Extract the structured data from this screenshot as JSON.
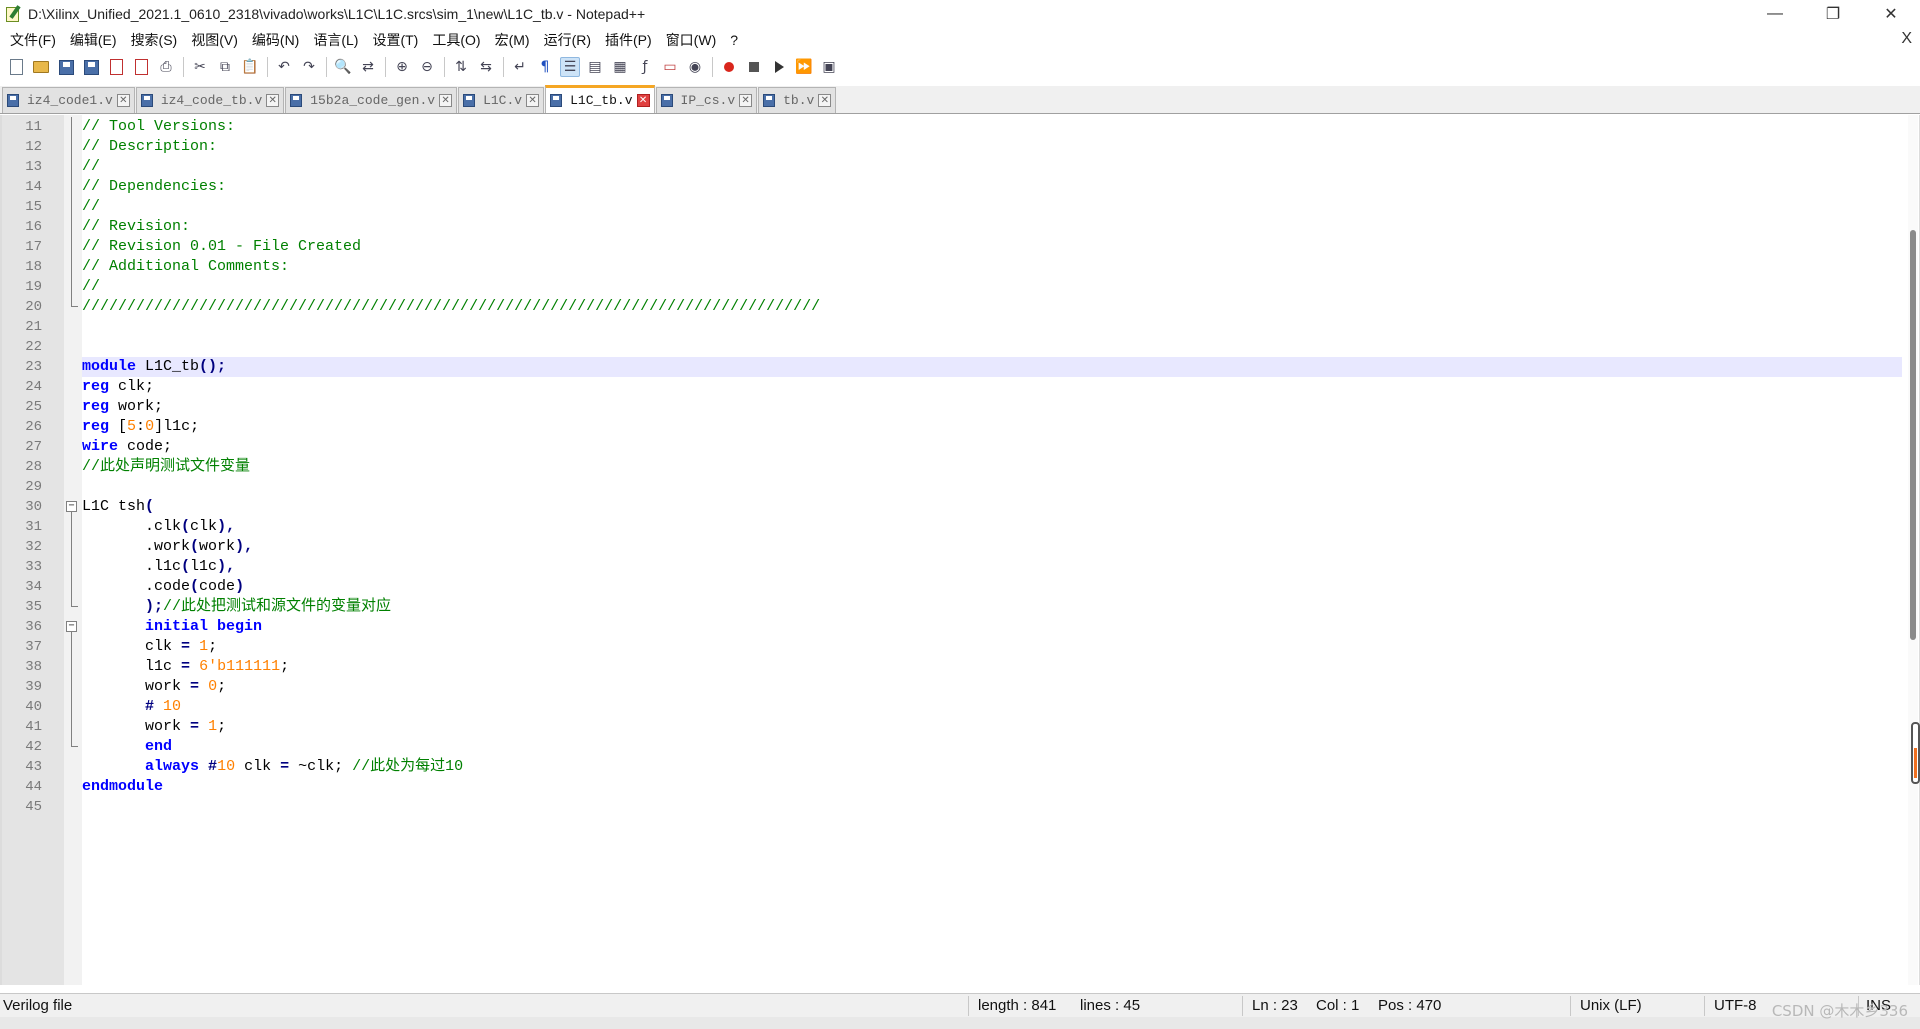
{
  "window": {
    "title": "D:\\Xilinx_Unified_2021.1_0610_2318\\vivado\\works\\L1C\\L1C.srcs\\sim_1\\new\\L1C_tb.v - Notepad++",
    "minimize": "—",
    "maximize": "❐",
    "close": "✕"
  },
  "menu": {
    "items": [
      "文件(F)",
      "编辑(E)",
      "搜索(S)",
      "视图(V)",
      "编码(N)",
      "语言(L)",
      "设置(T)",
      "工具(O)",
      "宏(M)",
      "运行(R)",
      "插件(P)",
      "窗口(W)",
      "?"
    ],
    "close": "X"
  },
  "toolbar": {
    "icons": [
      "new-file-icon",
      "open-file-icon",
      "save-icon",
      "save-all-icon",
      "close-icon",
      "close-all-icon",
      "print-icon",
      "cut-icon",
      "copy-icon",
      "paste-icon",
      "undo-icon",
      "redo-icon",
      "find-icon",
      "replace-icon",
      "zoom-in-icon",
      "zoom-out-icon",
      "sync-vertical-icon",
      "sync-horizontal-icon",
      "word-wrap-icon",
      "show-all-chars-icon",
      "indent-guide-icon",
      "language-icon",
      "doc-map-icon",
      "function-list-icon",
      "folder-workspace-icon",
      "monitor-icon",
      "record-macro-icon",
      "stop-macro-icon",
      "play-macro-icon",
      "run-macro-multiple-icon",
      "save-macro-icon"
    ]
  },
  "tabs": [
    {
      "label": "iz4_code1.v",
      "active": false
    },
    {
      "label": "iz4_code_tb.v",
      "active": false
    },
    {
      "label": "15b2a_code_gen.v",
      "active": false
    },
    {
      "label": "L1C.v",
      "active": false
    },
    {
      "label": "L1C_tb.v",
      "active": true
    },
    {
      "label": "IP_cs.v",
      "active": false
    },
    {
      "label": "tb.v",
      "active": false
    }
  ],
  "editor": {
    "current_line": 23,
    "lines": [
      {
        "n": "11",
        "tokens": [
          [
            "c-comment",
            "// Tool Versions:"
          ]
        ]
      },
      {
        "n": "12",
        "tokens": [
          [
            "c-comment",
            "// Description:"
          ]
        ]
      },
      {
        "n": "13",
        "tokens": [
          [
            "c-comment",
            "//"
          ]
        ]
      },
      {
        "n": "14",
        "tokens": [
          [
            "c-comment",
            "// Dependencies:"
          ]
        ]
      },
      {
        "n": "15",
        "tokens": [
          [
            "c-comment",
            "//"
          ]
        ]
      },
      {
        "n": "16",
        "tokens": [
          [
            "c-comment",
            "// Revision:"
          ]
        ]
      },
      {
        "n": "17",
        "tokens": [
          [
            "c-comment",
            "// Revision 0.01 - File Created"
          ]
        ]
      },
      {
        "n": "18",
        "tokens": [
          [
            "c-comment",
            "// Additional Comments:"
          ]
        ]
      },
      {
        "n": "19",
        "tokens": [
          [
            "c-comment",
            "//"
          ]
        ]
      },
      {
        "n": "20",
        "tokens": [
          [
            "c-comment",
            "//////////////////////////////////////////////////////////////////////////////////"
          ]
        ]
      },
      {
        "n": "21",
        "tokens": []
      },
      {
        "n": "22",
        "tokens": []
      },
      {
        "n": "23",
        "tokens": [
          [
            "c-kw",
            "module"
          ],
          [
            "c-text",
            " L1C_tb"
          ],
          [
            "c-op",
            "();"
          ]
        ]
      },
      {
        "n": "24",
        "tokens": [
          [
            "c-kw",
            "reg"
          ],
          [
            "c-text",
            " clk;"
          ]
        ]
      },
      {
        "n": "25",
        "tokens": [
          [
            "c-kw",
            "reg"
          ],
          [
            "c-text",
            " work;"
          ]
        ]
      },
      {
        "n": "26",
        "tokens": [
          [
            "c-kw",
            "reg"
          ],
          [
            "c-text",
            " ["
          ],
          [
            "c-num",
            "5"
          ],
          [
            "c-text",
            ":"
          ],
          [
            "c-num",
            "0"
          ],
          [
            "c-text",
            "]l1c;"
          ]
        ]
      },
      {
        "n": "27",
        "tokens": [
          [
            "c-kw",
            "wire"
          ],
          [
            "c-text",
            " code;"
          ]
        ]
      },
      {
        "n": "28",
        "tokens": [
          [
            "c-comment",
            "//此处声明测试文件变量"
          ]
        ]
      },
      {
        "n": "29",
        "tokens": []
      },
      {
        "n": "30",
        "tokens": [
          [
            "c-text",
            "L1C tsh"
          ],
          [
            "c-op",
            "("
          ]
        ]
      },
      {
        "n": "31",
        "tokens": [
          [
            "c-text",
            "       .clk"
          ],
          [
            "c-op",
            "("
          ],
          [
            "c-text",
            "clk"
          ],
          [
            "c-op",
            "),"
          ]
        ]
      },
      {
        "n": "32",
        "tokens": [
          [
            "c-text",
            "       .work"
          ],
          [
            "c-op",
            "("
          ],
          [
            "c-text",
            "work"
          ],
          [
            "c-op",
            "),"
          ]
        ]
      },
      {
        "n": "33",
        "tokens": [
          [
            "c-text",
            "       .l1c"
          ],
          [
            "c-op",
            "("
          ],
          [
            "c-text",
            "l1c"
          ],
          [
            "c-op",
            "),"
          ]
        ]
      },
      {
        "n": "34",
        "tokens": [
          [
            "c-text",
            "       .code"
          ],
          [
            "c-op",
            "("
          ],
          [
            "c-text",
            "code"
          ],
          [
            "c-op",
            ")"
          ]
        ]
      },
      {
        "n": "35",
        "tokens": [
          [
            "c-text",
            "       "
          ],
          [
            "c-op",
            ");"
          ],
          [
            "c-comment",
            "//此处把测试和源文件的变量对应"
          ]
        ]
      },
      {
        "n": "36",
        "tokens": [
          [
            "c-text",
            "       "
          ],
          [
            "c-kw",
            "initial begin"
          ]
        ]
      },
      {
        "n": "37",
        "tokens": [
          [
            "c-text",
            "       clk "
          ],
          [
            "c-op",
            "="
          ],
          [
            "c-text",
            " "
          ],
          [
            "c-num",
            "1"
          ],
          [
            "c-text",
            ";"
          ]
        ]
      },
      {
        "n": "38",
        "tokens": [
          [
            "c-text",
            "       l1c "
          ],
          [
            "c-op",
            "="
          ],
          [
            "c-text",
            " "
          ],
          [
            "c-num",
            "6'b111111"
          ],
          [
            "c-text",
            ";"
          ]
        ]
      },
      {
        "n": "39",
        "tokens": [
          [
            "c-text",
            "       work "
          ],
          [
            "c-op",
            "="
          ],
          [
            "c-text",
            " "
          ],
          [
            "c-num",
            "0"
          ],
          [
            "c-text",
            ";"
          ]
        ]
      },
      {
        "n": "40",
        "tokens": [
          [
            "c-text",
            "       "
          ],
          [
            "c-op",
            "#"
          ],
          [
            "c-text",
            " "
          ],
          [
            "c-num",
            "10"
          ]
        ]
      },
      {
        "n": "41",
        "tokens": [
          [
            "c-text",
            "       work "
          ],
          [
            "c-op",
            "="
          ],
          [
            "c-text",
            " "
          ],
          [
            "c-num",
            "1"
          ],
          [
            "c-text",
            ";"
          ]
        ]
      },
      {
        "n": "42",
        "tokens": [
          [
            "c-text",
            "       "
          ],
          [
            "c-kw",
            "end"
          ]
        ]
      },
      {
        "n": "43",
        "tokens": [
          [
            "c-text",
            "       "
          ],
          [
            "c-kw",
            "always"
          ],
          [
            "c-text",
            " "
          ],
          [
            "c-op",
            "#"
          ],
          [
            "c-num",
            "10"
          ],
          [
            "c-text",
            " clk "
          ],
          [
            "c-op",
            "="
          ],
          [
            "c-text",
            " ~clk; "
          ],
          [
            "c-comment",
            "//此处为每过10"
          ]
        ]
      },
      {
        "n": "44",
        "tokens": [
          [
            "c-kw",
            "endmodule"
          ]
        ]
      },
      {
        "n": "45",
        "tokens": []
      }
    ]
  },
  "status": {
    "file_type": "Verilog file",
    "length": "length : 841",
    "lines": "lines : 45",
    "ln": "Ln : 23",
    "col": "Col : 1",
    "pos": "Pos : 470",
    "eol": "Unix (LF)",
    "encoding": "UTF-8",
    "mode": "INS"
  },
  "watermark": "CSDN @木木乡336"
}
